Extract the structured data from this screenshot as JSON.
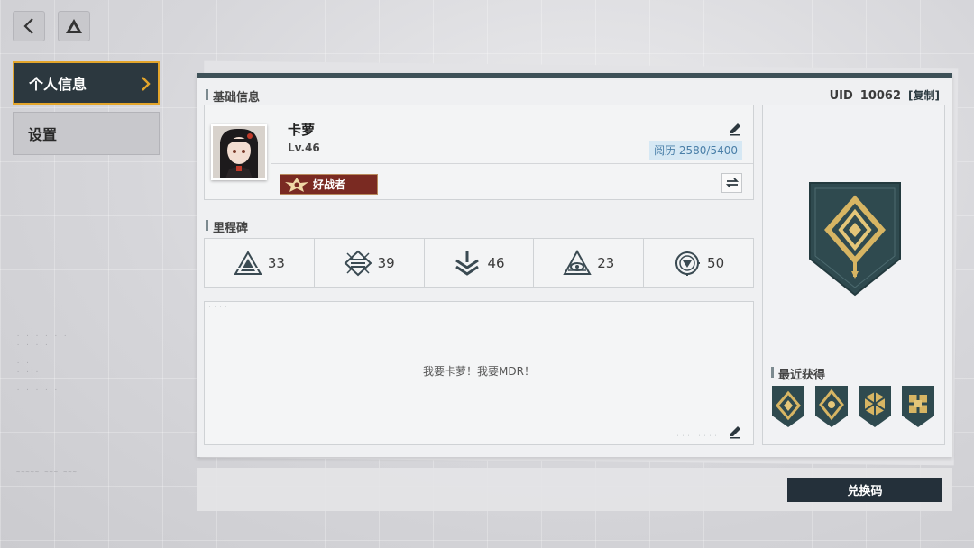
{
  "nav": {
    "back_icon": "chevron-left-icon",
    "home_icon": "triangle-logo-icon",
    "items": [
      {
        "label": "个人信息",
        "active": true
      },
      {
        "label": "设置",
        "active": false
      }
    ]
  },
  "basic_info": {
    "section_label": "基础信息",
    "uid_label": "UID",
    "uid_value": "10062",
    "copy_label": "[复制]",
    "name": "卡萝",
    "level": "Lv.46",
    "experience": "阅历 2580/5400",
    "title_badge": "好战者"
  },
  "milestones": {
    "section_label": "里程碑",
    "items": [
      {
        "icon": "triangle-peak-icon",
        "value": "33"
      },
      {
        "icon": "diamond-lines-icon",
        "value": "39"
      },
      {
        "icon": "arrow-chevrons-icon",
        "value": "46"
      },
      {
        "icon": "eye-triangle-icon",
        "value": "23"
      },
      {
        "icon": "target-circle-icon",
        "value": "50"
      }
    ]
  },
  "signature": {
    "text": "我要卡萝！我要MDR！"
  },
  "recent": {
    "section_label": "最近获得",
    "medals": [
      "medal-1-icon",
      "medal-2-icon",
      "medal-3-icon",
      "medal-4-icon"
    ]
  },
  "redeem_label": "兑换码",
  "colors": {
    "accent_gold": "#e3a52b",
    "dark_slate": "#2c383f",
    "badge_red": "#7a2a22",
    "exp_blue": "#4a7fa8"
  }
}
